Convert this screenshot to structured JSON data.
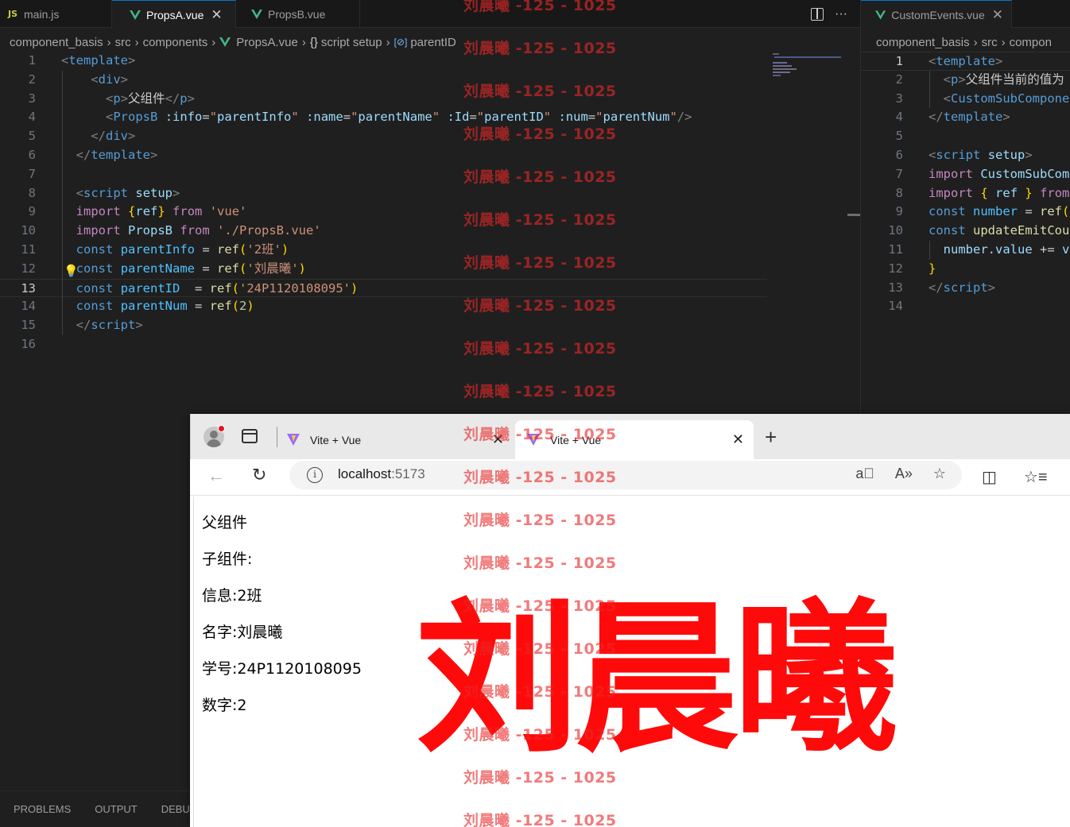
{
  "editor1": {
    "tabs": [
      {
        "label": "main.js",
        "icon": "js-icon",
        "active": false
      },
      {
        "label": "PropsA.vue",
        "icon": "vue-icon",
        "active": true
      },
      {
        "label": "PropsB.vue",
        "icon": "vue-icon",
        "active": false
      }
    ],
    "breadcrumb": [
      "component_basis",
      "src",
      "components",
      "PropsA.vue",
      "script setup",
      "parentID"
    ],
    "lines": [
      {
        "n": "1",
        "html": "<span class='t-tag'>&lt;</span><span class='t-name'>template</span><span class='t-tag'>&gt;</span>"
      },
      {
        "n": "2",
        "html": "    <span class='t-tag'>&lt;</span><span class='t-name'>div</span><span class='t-tag'>&gt;</span>"
      },
      {
        "n": "3",
        "html": "      <span class='t-tag'>&lt;</span><span class='t-name'>p</span><span class='t-tag'>&gt;</span><span class='t-def'>父组件</span><span class='t-tag'>&lt;/</span><span class='t-name'>p</span><span class='t-tag'>&gt;</span>"
      },
      {
        "n": "4",
        "html": "      <span class='t-tag'>&lt;</span><span class='t-name'>PropsB</span> <span class='t-attr'>:info</span>=<span class='t-str'>\"</span><span class='t-attr'>parentInfo</span><span class='t-str'>\"</span> <span class='t-attr'>:name</span>=<span class='t-str'>\"</span><span class='t-attr'>parentName</span><span class='t-str'>\"</span> <span class='t-attr'>:Id</span>=<span class='t-str'>\"</span><span class='t-attr'>parentID</span><span class='t-str'>\"</span> <span class='t-attr'>:num</span>=<span class='t-str'>\"</span><span class='t-attr'>parentNum</span><span class='t-str'>\"</span><span class='t-tag'>/&gt;</span>"
      },
      {
        "n": "5",
        "html": "    <span class='t-tag'>&lt;/</span><span class='t-name'>div</span><span class='t-tag'>&gt;</span>"
      },
      {
        "n": "6",
        "html": "  <span class='t-tag'>&lt;/</span><span class='t-name'>template</span><span class='t-tag'>&gt;</span>"
      },
      {
        "n": "7",
        "html": ""
      },
      {
        "n": "8",
        "html": "  <span class='t-tag'>&lt;</span><span class='t-name'>script</span> <span class='t-attr'>setup</span><span class='t-tag'>&gt;</span>"
      },
      {
        "n": "9",
        "html": "  <span class='t-kw'>import</span> <span class='t-br'>{</span><span class='t-attr'>ref</span><span class='t-br'>}</span> <span class='t-kw'>from</span> <span class='t-str'>'vue'</span>"
      },
      {
        "n": "10",
        "html": "  <span class='t-kw'>import</span> <span class='t-attr'>PropsB</span> <span class='t-kw'>from</span> <span class='t-str'>'./PropsB.vue'</span>"
      },
      {
        "n": "11",
        "html": "  <span class='t-name'>const</span> <span class='t-var'>parentInfo</span> = <span class='t-fn'>ref</span><span class='t-br'>(</span><span class='t-str'>'2班'</span><span class='t-br'>)</span>"
      },
      {
        "n": "12",
        "html": "  <span class='t-name'>const</span> <span class='t-var'>parentName</span> = <span class='t-fn'>ref</span><span class='t-br'>(</span><span class='t-str'>'刘晨曦'</span><span class='t-br'>)</span>",
        "bulb": true
      },
      {
        "n": "13",
        "html": "  <span class='t-name'>const</span> <span class='t-var'>parentID</span>  = <span class='t-fn'>ref</span><span class='t-br'>(</span><span class='t-str'>'24P1120108095'</span><span class='t-br'>)</span>",
        "current": true
      },
      {
        "n": "14",
        "html": "  <span class='t-name'>const</span> <span class='t-var'>parentNum</span> = <span class='t-fn'>ref</span><span class='t-br'>(</span><span class='t-num'>2</span><span class='t-br'>)</span>"
      },
      {
        "n": "15",
        "html": "  <span class='t-tag'>&lt;/</span><span class='t-name'>script</span><span class='t-tag'>&gt;</span>"
      },
      {
        "n": "16",
        "html": ""
      }
    ],
    "panel_tabs": [
      "PROBLEMS",
      "OUTPUT",
      "DEBUG"
    ]
  },
  "editor2": {
    "tabs": [
      {
        "label": "CustomEvents.vue",
        "icon": "vue-icon",
        "active": true
      }
    ],
    "breadcrumb": [
      "component_basis",
      "src",
      "compon"
    ],
    "lines": [
      {
        "n": "1",
        "html": "<span class='t-tag'>&lt;</span><span class='t-name'>template</span><span class='t-tag'>&gt;</span>",
        "current": true
      },
      {
        "n": "2",
        "html": "  <span class='t-tag'>&lt;</span><span class='t-name'>p</span><span class='t-tag'>&gt;</span><span class='t-def'>父组件当前的值为</span>"
      },
      {
        "n": "3",
        "html": "  <span class='t-tag'>&lt;</span><span class='t-name'>CustomSubCompone</span>"
      },
      {
        "n": "4",
        "html": "<span class='t-tag'>&lt;/</span><span class='t-name'>template</span><span class='t-tag'>&gt;</span>"
      },
      {
        "n": "5",
        "html": ""
      },
      {
        "n": "6",
        "html": "<span class='t-tag'>&lt;</span><span class='t-name'>script</span> <span class='t-attr'>setup</span><span class='t-tag'>&gt;</span>"
      },
      {
        "n": "7",
        "html": "<span class='t-kw'>import</span> <span class='t-attr'>CustomSubCom</span>"
      },
      {
        "n": "8",
        "html": "<span class='t-kw'>import</span> <span class='t-br'>{</span> <span class='t-attr'>ref</span> <span class='t-br'>}</span> <span class='t-kw'>from</span>"
      },
      {
        "n": "9",
        "html": "<span class='t-name'>const</span> <span class='t-var'>number</span> = <span class='t-fn'>ref</span><span class='t-br'>(</span>"
      },
      {
        "n": "10",
        "html": "<span class='t-name'>const</span> <span class='t-fn'>updateEmitCou</span>"
      },
      {
        "n": "11",
        "html": "  <span class='t-attr'>number</span>.<span class='t-attr'>value</span> += <span class='t-attr'>v</span>"
      },
      {
        "n": "12",
        "html": "<span class='t-br'>}</span>"
      },
      {
        "n": "13",
        "html": "<span class='t-tag'>&lt;/</span><span class='t-name'>script</span><span class='t-tag'>&gt;</span>"
      },
      {
        "n": "14",
        "html": ""
      }
    ]
  },
  "browser": {
    "tabs": [
      {
        "label": "Vite + Vue"
      },
      {
        "label": "Vite + Vue"
      }
    ],
    "url_host": "localhost",
    "url_port": ":5173",
    "page_lines": [
      "父组件",
      "子组件:",
      "信息:2班",
      "名字:刘晨曦",
      "学号:24P1120108095",
      "数字:2"
    ]
  },
  "watermark": "刘晨曦 -125 - 1025",
  "overlay_name": "刘晨曦"
}
